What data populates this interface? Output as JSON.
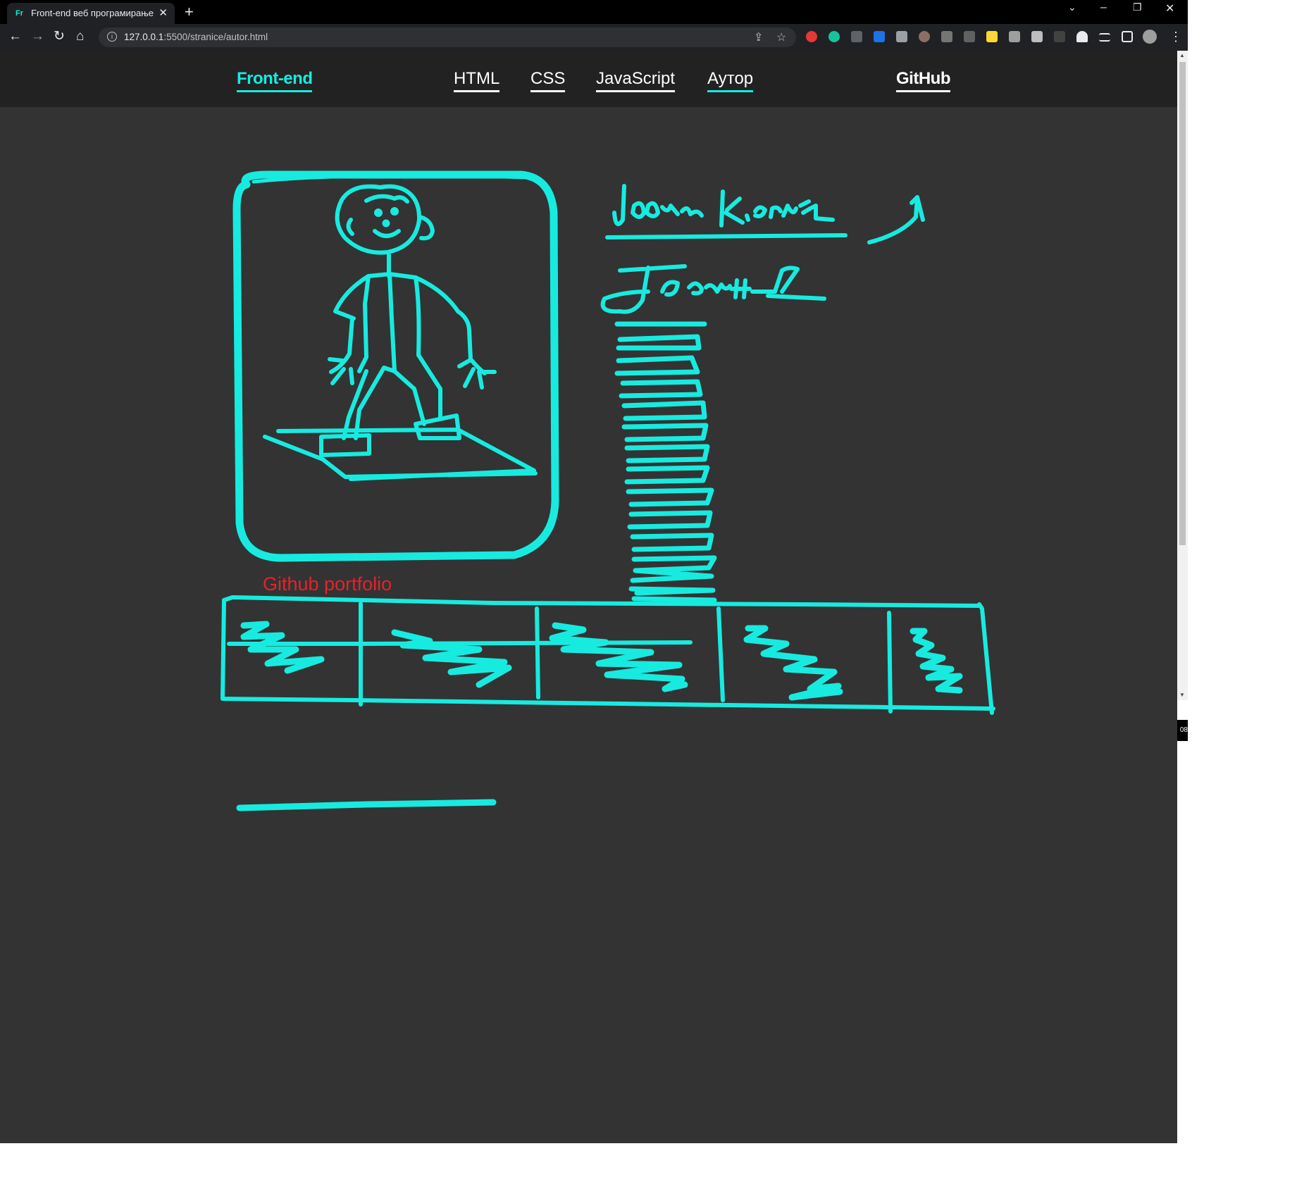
{
  "browser": {
    "tab_title": "Front-end веб програмирање",
    "tab_favicon": "Fr",
    "url_host": "127.0.0.1",
    "url_rest": ":5500/stranice/autor.html"
  },
  "site": {
    "brand": "Front-end",
    "nav": [
      "HTML",
      "CSS",
      "JavaScript",
      "Аутор"
    ],
    "github": "GitHub",
    "portfolio_label": "Github portfolio",
    "accent": "#17ebe0",
    "background": "#333333",
    "header_background": "#222222"
  },
  "side_badge": "08"
}
